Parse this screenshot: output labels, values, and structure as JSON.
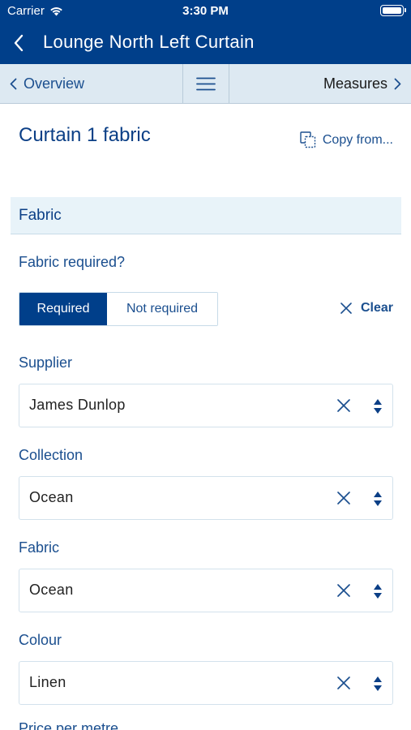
{
  "status_bar": {
    "carrier": "Carrier",
    "time": "3:30 PM"
  },
  "nav": {
    "title": "Lounge North Left Curtain"
  },
  "segbar": {
    "prev_label": "Overview",
    "next_label": "Measures"
  },
  "page": {
    "title": "Curtain 1 fabric",
    "copy_from_label": "Copy from..."
  },
  "section": {
    "title": "Fabric"
  },
  "fabric_required": {
    "question": "Fabric required?",
    "options": [
      "Required",
      "Not required"
    ],
    "selected": "Required",
    "clear_label": "Clear"
  },
  "fields": [
    {
      "label": "Supplier",
      "value": "James Dunlop"
    },
    {
      "label": "Collection",
      "value": "Ocean"
    },
    {
      "label": "Fabric",
      "value": "Ocean"
    },
    {
      "label": "Colour",
      "value": "Linen"
    }
  ],
  "next_field_label": "Price per metre",
  "colors": {
    "primary": "#003f8a",
    "segbar_bg": "#dde9f2",
    "section_bg": "#e8f3f9",
    "label_text": "#1b4f8f"
  }
}
